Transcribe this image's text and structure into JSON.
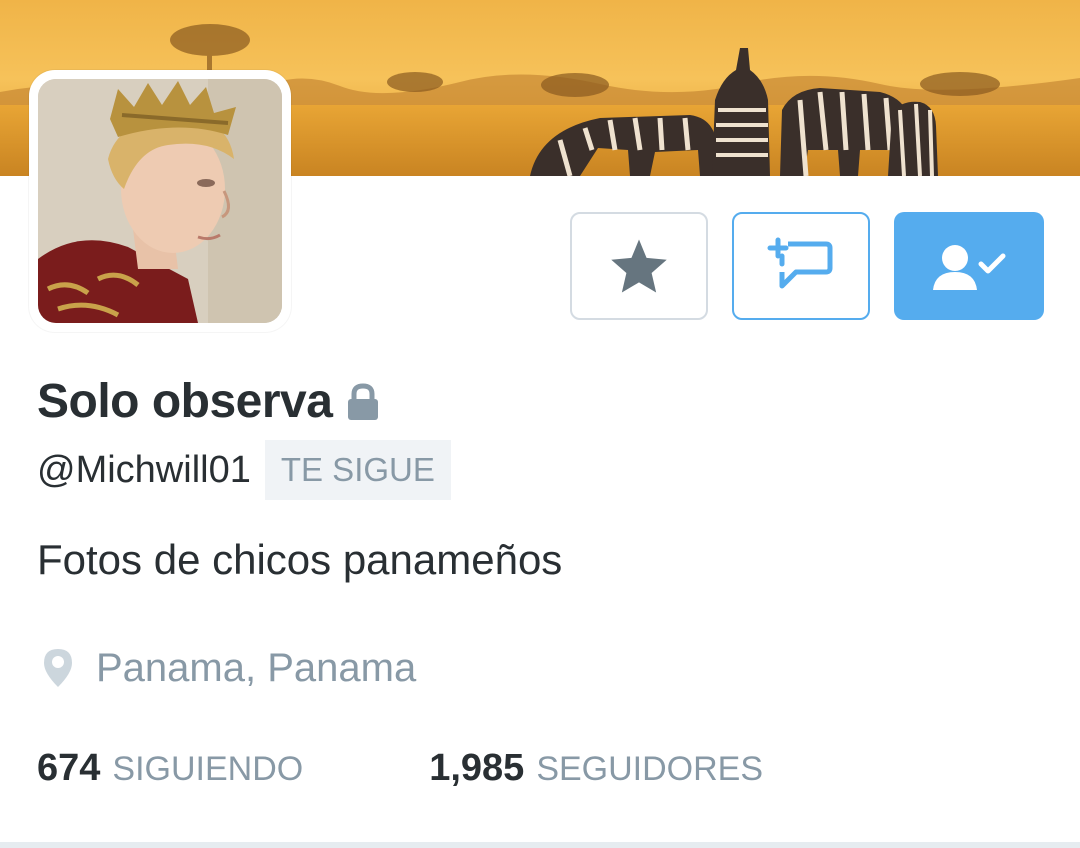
{
  "profile": {
    "name": "Solo observa",
    "handle": "@Michwill01",
    "follows_you_badge": "TE SIGUE",
    "bio": "Fotos de chicos panameños",
    "location": "Panama, Panama"
  },
  "stats": {
    "following_count": "674",
    "following_label": "SIGUIENDO",
    "followers_count": "1,985",
    "followers_label": "SEGUIDORES"
  },
  "actions": {
    "favorite_icon": "star-icon",
    "dm_icon": "add-message-icon",
    "follow_icon": "following-user-check-icon"
  },
  "colors": {
    "accent": "#55acee",
    "text": "#292f33",
    "muted": "#8899a6"
  }
}
